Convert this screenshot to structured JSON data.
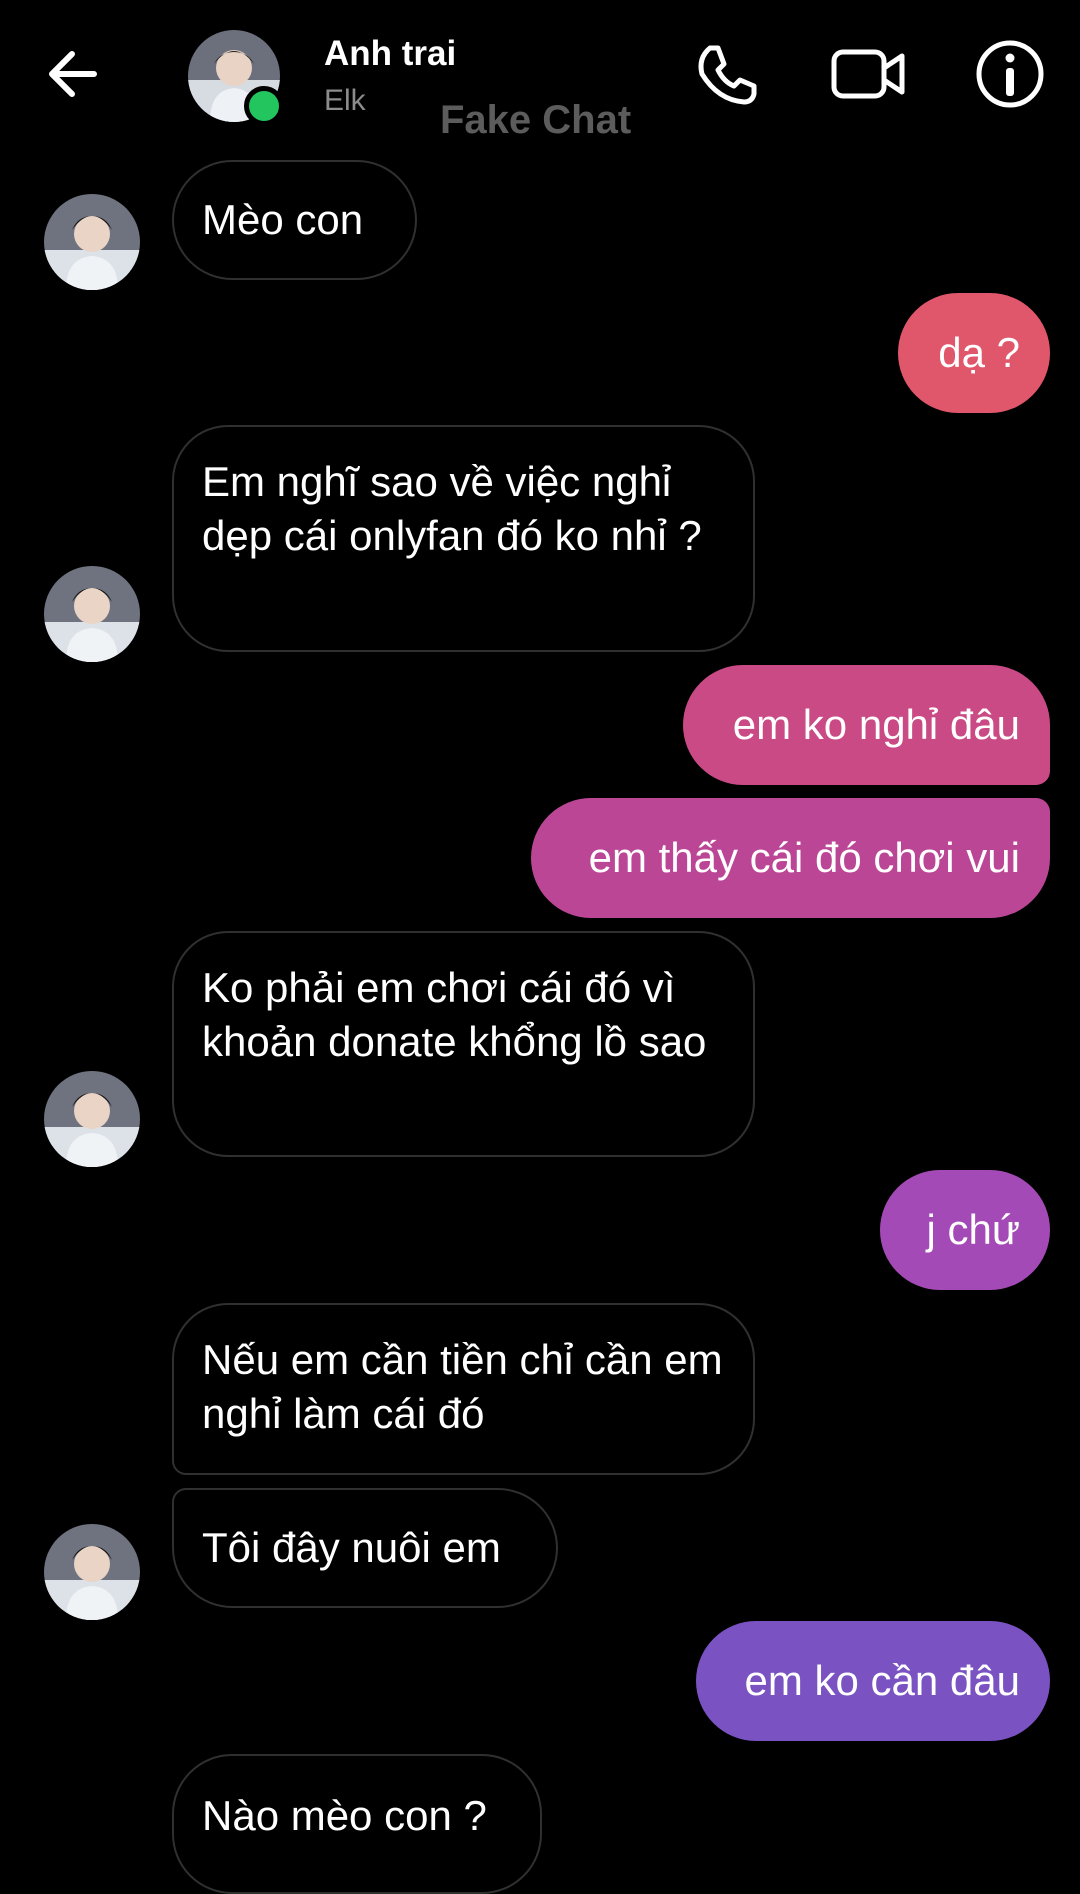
{
  "header": {
    "contact_name": "Anh trai",
    "contact_status": "Elk",
    "watermark": "Fake Chat",
    "back_icon": "arrow-left-icon",
    "call_icon": "phone-icon",
    "video_icon": "video-camera-icon",
    "info_icon": "info-icon",
    "online_color": "#22c55e"
  },
  "messages": [
    {
      "from": "contact",
      "text": "Mèo con"
    },
    {
      "from": "me",
      "text": "dạ ?"
    },
    {
      "from": "contact",
      "text": "Em nghĩ sao về việc nghỉ dẹp cái onlyfan đó ko nhỉ ?"
    },
    {
      "from": "me",
      "text": "em ko nghỉ đâu"
    },
    {
      "from": "me",
      "text": "em thấy cái đó chơi vui"
    },
    {
      "from": "contact",
      "text": "Ko phải em chơi cái đó vì khoản donate khổng lồ sao"
    },
    {
      "from": "me",
      "text": "j chứ"
    },
    {
      "from": "contact",
      "text": "Nếu em cần tiền chỉ cần em nghỉ làm cái đó"
    },
    {
      "from": "contact",
      "text": "Tôi đây nuôi em"
    },
    {
      "from": "me",
      "text": "em ko cần đâu"
    },
    {
      "from": "contact",
      "text": "Nào mèo con ?"
    }
  ],
  "colors": {
    "outgoing_gradient": [
      "#e0566b",
      "#c5468f",
      "#a548b5",
      "#7a52c2"
    ],
    "incoming_border": "#303030"
  }
}
